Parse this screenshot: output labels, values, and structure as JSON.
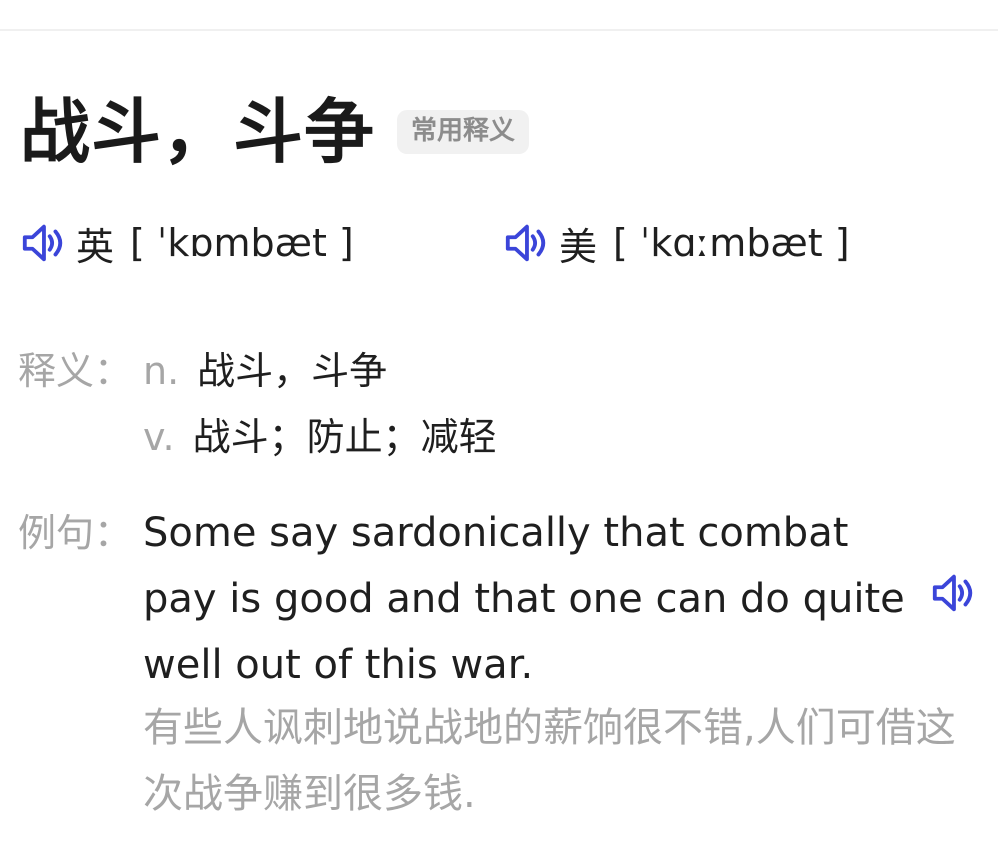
{
  "entry": {
    "headword": "战斗，斗争",
    "badge": "常用释义"
  },
  "pronunciations": [
    {
      "region": "英",
      "ipa": "[ ˈkɒmbæt ]",
      "icon": "speaker-icon"
    },
    {
      "region": "美",
      "ipa": "[ ˈkɑːmbæt ]",
      "icon": "speaker-icon"
    }
  ],
  "definitions": {
    "label": "释义：",
    "items": [
      {
        "pos": "n.",
        "meaning": "战斗，斗争"
      },
      {
        "pos": "v.",
        "meaning": "战斗；防止；减轻"
      }
    ]
  },
  "example": {
    "label": "例句：",
    "sentence": "Some say sardonically that combat pay is good and that one can do quite well out of this war.",
    "translation": "有些人讽刺地说战地的薪饷很不错,人们可借这次战争赚到很多钱.",
    "icon": "speaker-icon"
  },
  "colors": {
    "accent": "#3b45d9",
    "muted": "#a6a6a6",
    "text": "#1f1f1f",
    "badge_bg": "#f1f1f1"
  }
}
